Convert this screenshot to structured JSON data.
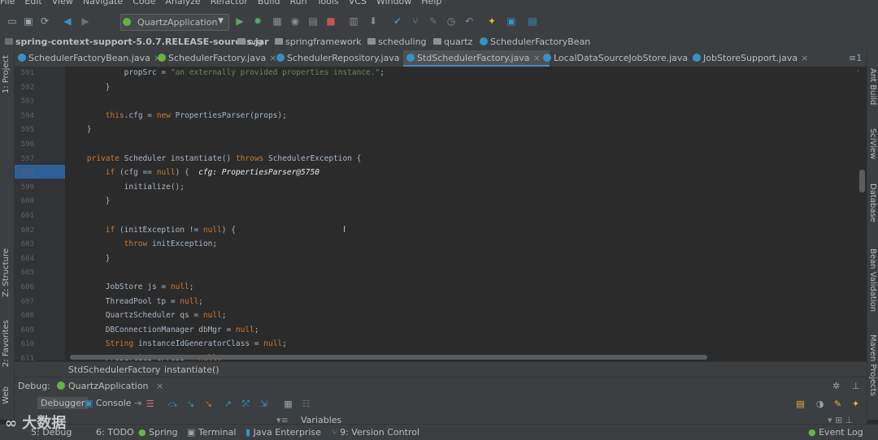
{
  "menu": [
    "File",
    "Edit",
    "View",
    "Navigate",
    "Code",
    "Analyze",
    "Refactor",
    "Build",
    "Run",
    "Tools",
    "VCS",
    "Window",
    "Help"
  ],
  "run_config": "QuartzApplication",
  "breadcrumbs": [
    "spring-context-support-5.0.7.RELEASE-sources.jar",
    "org",
    "springframework",
    "scheduling",
    "quartz",
    "SchedulerFactoryBean"
  ],
  "tabs": [
    {
      "label": "SchedulerFactoryBean.java",
      "active": false
    },
    {
      "label": "SchedulerFactory.java",
      "active": false
    },
    {
      "label": "SchedulerRepository.java",
      "active": false
    },
    {
      "label": "StdSchedulerFactory.java",
      "active": true
    },
    {
      "label": "LocalDataSourceJobStore.java",
      "active": false
    },
    {
      "label": "JobStoreSupport.java",
      "active": false
    }
  ],
  "tab_overflow": "≡1",
  "code_lines": [
    {
      "n": "591",
      "t": "            propSrc = \"an externally provided properties instance.\";"
    },
    {
      "n": "592",
      "t": "        }"
    },
    {
      "n": "593",
      "t": ""
    },
    {
      "n": "594",
      "t": "        this.cfg = new PropertiesParser(props);"
    },
    {
      "n": "595",
      "t": "    }"
    },
    {
      "n": "596",
      "t": ""
    },
    {
      "n": "597",
      "t": "    private Scheduler instantiate() throws SchedulerException {"
    },
    {
      "n": "598",
      "t": "        if (cfg == null) {  cfg: PropertiesParser@5750"
    },
    {
      "n": "599",
      "t": "            initialize();"
    },
    {
      "n": "600",
      "t": "        }"
    },
    {
      "n": "601",
      "t": ""
    },
    {
      "n": "602",
      "t": "        if (initException != null) {"
    },
    {
      "n": "603",
      "t": "            throw initException;"
    },
    {
      "n": "604",
      "t": "        }"
    },
    {
      "n": "605",
      "t": ""
    },
    {
      "n": "606",
      "t": "        JobStore js = null;"
    },
    {
      "n": "607",
      "t": "        ThreadPool tp = null;"
    },
    {
      "n": "608",
      "t": "        QuartzScheduler qs = null;"
    },
    {
      "n": "609",
      "t": "        DBConnectionManager dbMgr = null;"
    },
    {
      "n": "610",
      "t": "        String instanceIdGeneratorClass = null;"
    },
    {
      "n": "611",
      "t": "        Properties tProps = null;"
    }
  ],
  "editor_crumb": [
    "StdSchedulerFactory",
    "instantiate()"
  ],
  "left_tools": [
    "1: Project",
    "Z: Structure",
    "2: Favorites",
    "Web"
  ],
  "right_tools": [
    "Ant Build",
    "SciView",
    "Database",
    "Bean Validation",
    "Maven Projects"
  ],
  "debug": {
    "label": "Debug:",
    "session": "QuartzApplication",
    "tabs": [
      "Debugger",
      "Console"
    ],
    "variables": "Variables"
  },
  "status_items": [
    "5: Debug",
    "6: TODO",
    "Spring",
    "Terminal",
    "Java Enterprise",
    "9: Version Control"
  ],
  "event_log": "Event Log",
  "watermark": "大数据"
}
